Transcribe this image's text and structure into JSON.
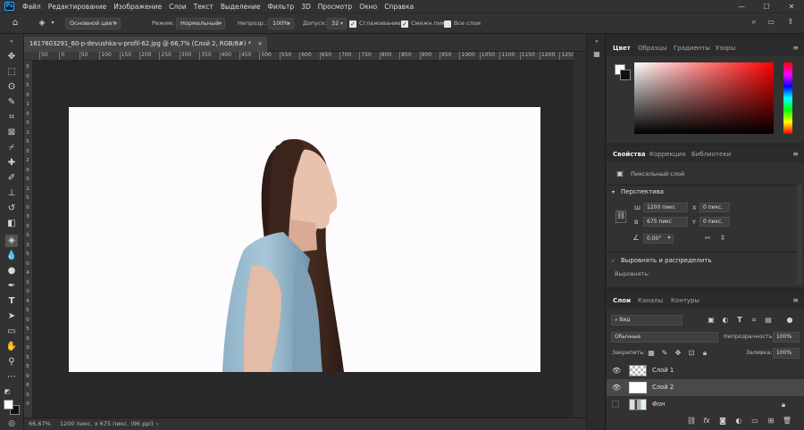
{
  "app": {
    "logo": "Ps",
    "menu": [
      "Файл",
      "Редактирование",
      "Изображение",
      "Слои",
      "Текст",
      "Выделение",
      "Фильтр",
      "3D",
      "Просмотр",
      "Окно",
      "Справка"
    ]
  },
  "options_bar": {
    "fill_source": "Основной цвет",
    "mode_label": "Режим:",
    "mode_value": "Нормальный",
    "opacity_label": "Непрозр.:",
    "opacity_value": "100%",
    "tolerance_label": "Допуск:",
    "tolerance_value": "32",
    "antialias_label": "Сглаживание",
    "contiguous_label": "Смежн.пикс",
    "all_layers_label": "Все слои"
  },
  "document": {
    "tab_title": "1617603291_60-p-devushka-v-profil-62.jpg @ 66,7% (Слой 2, RGB/8#) *",
    "close_glyph": "×",
    "zoom": "66,67%",
    "doc_info": "1200 пикс. x 675 пикс. (96 ppi)",
    "status_arrow": "›"
  },
  "ruler": {
    "top_labels": [
      "50",
      "0",
      "50",
      "100",
      "150",
      "200",
      "250",
      "300",
      "350",
      "400",
      "450",
      "500",
      "550",
      "600",
      "650",
      "700",
      "750",
      "800",
      "850",
      "900",
      "950",
      "1000",
      "1050",
      "1100",
      "1150",
      "1200",
      "1250"
    ],
    "left_labels": [
      "5",
      "0",
      "5",
      "0",
      "1",
      "0",
      "0",
      "1",
      "5",
      "0",
      "2",
      "0",
      "0",
      "2",
      "5",
      "0",
      "3",
      "0",
      "0",
      "3",
      "5",
      "0",
      "4",
      "0",
      "0",
      "4",
      "5",
      "0",
      "5",
      "0",
      "0",
      "5",
      "5",
      "0",
      "6",
      "0",
      "0"
    ]
  },
  "color_panel": {
    "tabs": [
      "Цвет",
      "Образцы",
      "Градиенты",
      "Узоры"
    ],
    "hue_color": "#ff0000"
  },
  "properties_panel": {
    "tabs": [
      "Свойства",
      "Коррекция",
      "Библиотеки"
    ],
    "layer_type": "Пиксельный слой",
    "section_transform": "Перспектива",
    "w_label": "Ш",
    "w_value": "1200 пикс",
    "x_label": "X",
    "x_value": "0 пикс.",
    "h_label": "В",
    "h_value": "675 пикс",
    "y_label": "Y",
    "y_value": "0 пикс.",
    "angle_value": "0,00°",
    "section_align": "Выровнять и распределить",
    "align_label": "Выровнять:"
  },
  "layers_panel": {
    "tabs": [
      "Слои",
      "Каналы",
      "Контуры"
    ],
    "filter_kind": "Вид",
    "blend_mode": "Обычные",
    "opacity_label": "Непрозрачность:",
    "opacity_value": "100%",
    "lock_label": "Закрепить:",
    "fill_label": "Заливка:",
    "fill_value": "100%",
    "layers": [
      {
        "name": "Слой 1",
        "visible": true,
        "selected": false
      },
      {
        "name": "Слой 2",
        "visible": true,
        "selected": true
      },
      {
        "name": "Фон",
        "visible": false,
        "selected": false
      }
    ],
    "footer_icons": [
      "link-icon",
      "fx-icon",
      "mask-icon",
      "adjustment-icon",
      "group-icon",
      "new-layer-icon",
      "trash-icon"
    ]
  }
}
